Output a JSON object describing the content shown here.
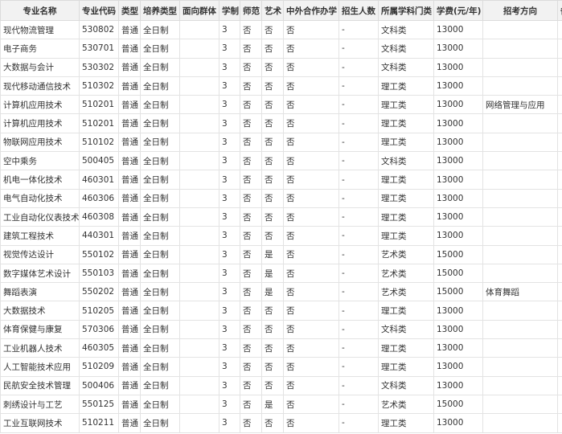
{
  "table": {
    "headers": [
      "专业名称",
      "专业代码",
      "类型",
      "培养类型",
      "面向群体",
      "学制",
      "师范",
      "艺术",
      "中外合作办学",
      "招生人数",
      "所属学科门类",
      "学费(元/年)",
      "招考方向",
      "备注"
    ],
    "rows": [
      [
        "现代物流管理",
        "530802",
        "普通",
        "全日制",
        "",
        "3",
        "否",
        "否",
        "否",
        "-",
        "文科类",
        "13000",
        "",
        ""
      ],
      [
        "电子商务",
        "530701",
        "普通",
        "全日制",
        "",
        "3",
        "否",
        "否",
        "否",
        "-",
        "文科类",
        "13000",
        "",
        ""
      ],
      [
        "大数据与会计",
        "530302",
        "普通",
        "全日制",
        "",
        "3",
        "否",
        "否",
        "否",
        "-",
        "文科类",
        "13000",
        "",
        ""
      ],
      [
        "现代移动通信技术",
        "510302",
        "普通",
        "全日制",
        "",
        "3",
        "否",
        "否",
        "否",
        "-",
        "理工类",
        "13000",
        "",
        ""
      ],
      [
        "计算机应用技术",
        "510201",
        "普通",
        "全日制",
        "",
        "3",
        "否",
        "否",
        "否",
        "-",
        "理工类",
        "13000",
        "网络管理与应用",
        ""
      ],
      [
        "计算机应用技术",
        "510201",
        "普通",
        "全日制",
        "",
        "3",
        "否",
        "否",
        "否",
        "-",
        "理工类",
        "13000",
        "",
        ""
      ],
      [
        "物联网应用技术",
        "510102",
        "普通",
        "全日制",
        "",
        "3",
        "否",
        "否",
        "否",
        "-",
        "理工类",
        "13000",
        "",
        ""
      ],
      [
        "空中乘务",
        "500405",
        "普通",
        "全日制",
        "",
        "3",
        "否",
        "否",
        "否",
        "-",
        "文科类",
        "13000",
        "",
        ""
      ],
      [
        "机电一体化技术",
        "460301",
        "普通",
        "全日制",
        "",
        "3",
        "否",
        "否",
        "否",
        "-",
        "理工类",
        "13000",
        "",
        ""
      ],
      [
        "电气自动化技术",
        "460306",
        "普通",
        "全日制",
        "",
        "3",
        "否",
        "否",
        "否",
        "-",
        "理工类",
        "13000",
        "",
        ""
      ],
      [
        "工业自动化仪表技术",
        "460308",
        "普通",
        "全日制",
        "",
        "3",
        "否",
        "否",
        "否",
        "-",
        "理工类",
        "13000",
        "",
        ""
      ],
      [
        "建筑工程技术",
        "440301",
        "普通",
        "全日制",
        "",
        "3",
        "否",
        "否",
        "否",
        "-",
        "理工类",
        "13000",
        "",
        ""
      ],
      [
        "视觉传达设计",
        "550102",
        "普通",
        "全日制",
        "",
        "3",
        "否",
        "是",
        "否",
        "-",
        "艺术类",
        "15000",
        "",
        ""
      ],
      [
        "数字媒体艺术设计",
        "550103",
        "普通",
        "全日制",
        "",
        "3",
        "否",
        "是",
        "否",
        "-",
        "艺术类",
        "15000",
        "",
        ""
      ],
      [
        "舞蹈表演",
        "550202",
        "普通",
        "全日制",
        "",
        "3",
        "否",
        "是",
        "否",
        "-",
        "艺术类",
        "15000",
        "体育舞蹈",
        ""
      ],
      [
        "大数据技术",
        "510205",
        "普通",
        "全日制",
        "",
        "3",
        "否",
        "否",
        "否",
        "-",
        "理工类",
        "13000",
        "",
        ""
      ],
      [
        "体育保健与康复",
        "570306",
        "普通",
        "全日制",
        "",
        "3",
        "否",
        "否",
        "否",
        "-",
        "文科类",
        "13000",
        "",
        ""
      ],
      [
        "工业机器人技术",
        "460305",
        "普通",
        "全日制",
        "",
        "3",
        "否",
        "否",
        "否",
        "-",
        "理工类",
        "13000",
        "",
        ""
      ],
      [
        "人工智能技术应用",
        "510209",
        "普通",
        "全日制",
        "",
        "3",
        "否",
        "否",
        "否",
        "-",
        "理工类",
        "13000",
        "",
        ""
      ],
      [
        "民航安全技术管理",
        "500406",
        "普通",
        "全日制",
        "",
        "3",
        "否",
        "否",
        "否",
        "-",
        "文科类",
        "13000",
        "",
        ""
      ],
      [
        "刺绣设计与工艺",
        "550125",
        "普通",
        "全日制",
        "",
        "3",
        "否",
        "是",
        "否",
        "-",
        "艺术类",
        "15000",
        "",
        ""
      ],
      [
        "工业互联网技术",
        "510211",
        "普通",
        "全日制",
        "",
        "3",
        "否",
        "否",
        "否",
        "-",
        "理工类",
        "13000",
        "",
        ""
      ]
    ]
  }
}
